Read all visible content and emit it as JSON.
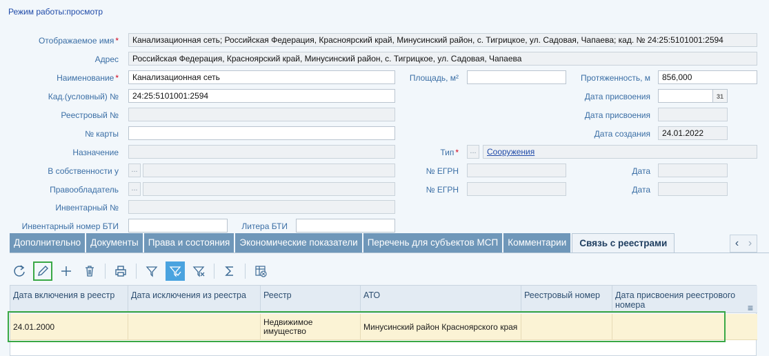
{
  "mode": "Режим работы:просмотр",
  "form": {
    "display_name_label": "Отображаемое имя",
    "display_name": "Канализационная сеть; Российская Федерация, Красноярский край, Минусинский район, с. Тигрицкое, ул. Садовая, Чапаева; кад. № 24:25:5101001:2594",
    "address_label": "Адрес",
    "address": "Российская Федерация, Красноярский край, Минусинский район, с. Тигрицкое, ул. Садовая, Чапаева",
    "name_label": "Наименование",
    "name": "Канализационная сеть",
    "area_label": "Площадь, м²",
    "area": "",
    "length_label": "Протяженность, м",
    "length": "856,000",
    "cad_label": "Кад.(условный) №",
    "cad": "24:25:5101001:2594",
    "assign_date_label": "Дата присвоения",
    "assign_date": "",
    "calendar_text": "31",
    "reg_num_label": "Реестровый №",
    "reg_num": "",
    "reg_date_label": "Дата присвоения",
    "reg_date": "",
    "map_num_label": "№ карты",
    "map_num": "",
    "created_label": "Дата создания",
    "created": "24.01.2022",
    "purpose_label": "Назначение",
    "purpose": "",
    "type_label": "Тип",
    "type": "Сооружения",
    "owned_by_label": "В собственности у",
    "egrn1_label": "№ ЕГРН",
    "date1_label": "Дата",
    "holder_label": "Правообладатель",
    "egrn2_label": "№ ЕГРН",
    "date2_label": "Дата",
    "inv_label": "Инвентарный №",
    "bti_inv_label": "Инвентарный номер БТИ",
    "bti_litera_label": "Литера БТИ",
    "dots": "..."
  },
  "tabs": [
    "Дополнительно",
    "Документы",
    "Права и состояния",
    "Экономические показатели",
    "Перечень для субъектов МСП",
    "Комментарии",
    "Связь с реестрами"
  ],
  "tabnav": {
    "prev": "‹",
    "next": "›"
  },
  "table": {
    "headers": [
      "Дата включения в реестр",
      "Дата исключения из реестра",
      "Реестр",
      "АТО",
      "Реестровый номер",
      "Дата присвоения реестрового номера"
    ],
    "rows": [
      [
        "24.01.2000",
        "",
        "Недвижимое имущество",
        "Минусинский район Красноярского края",
        "",
        ""
      ]
    ]
  },
  "colors": {
    "accent": "#6f97b9",
    "highlight": "#39a845",
    "row": "#fbf3d5"
  }
}
